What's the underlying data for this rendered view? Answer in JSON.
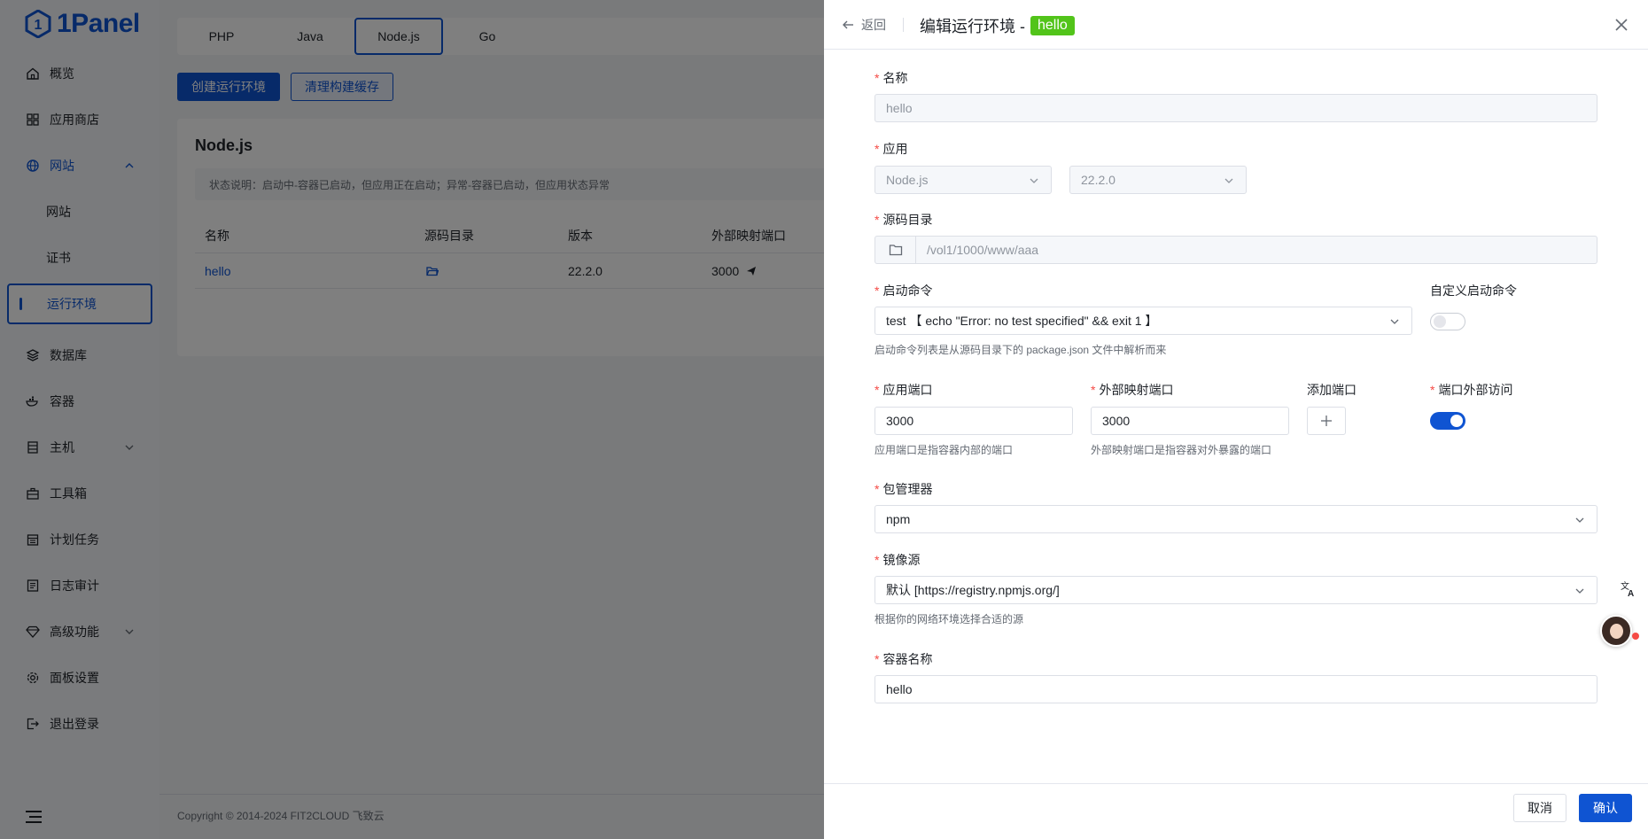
{
  "app": {
    "logo_text": "1Panel",
    "footer": "Copyright © 2014-2024 FIT2CLOUD 飞致云"
  },
  "sidebar": {
    "items": [
      {
        "label": "概览",
        "icon": "home-icon"
      },
      {
        "label": "应用商店",
        "icon": "grid-icon"
      },
      {
        "label": "网站",
        "icon": "globe-icon"
      },
      {
        "label": "网站",
        "icon": ""
      },
      {
        "label": "证书",
        "icon": ""
      },
      {
        "label": "运行环境",
        "icon": ""
      },
      {
        "label": "数据库",
        "icon": "layers-icon"
      },
      {
        "label": "容器",
        "icon": "docker-icon"
      },
      {
        "label": "主机",
        "icon": "server-icon"
      },
      {
        "label": "工具箱",
        "icon": "toolbox-icon"
      },
      {
        "label": "计划任务",
        "icon": "calendar-icon"
      },
      {
        "label": "日志审计",
        "icon": "log-icon"
      },
      {
        "label": "高级功能",
        "icon": "diamond-icon"
      },
      {
        "label": "面板设置",
        "icon": "gear-icon"
      },
      {
        "label": "退出登录",
        "icon": "logout-icon"
      }
    ]
  },
  "runtime_tabs": [
    "PHP",
    "Java",
    "Node.js",
    "Go"
  ],
  "toolbar": {
    "create_label": "创建运行环境",
    "clear_cache_label": "清理构建缓存"
  },
  "card": {
    "title": "Node.js",
    "status_note": "状态说明：启动中-容器已启动，但应用正在启动；异常-容器已启动，但应用状态异常"
  },
  "table": {
    "columns": [
      "名称",
      "源码目录",
      "版本",
      "外部映射端口"
    ],
    "rows": [
      {
        "name": "hello",
        "version": "22.2.0",
        "port": "3000"
      }
    ]
  },
  "drawer": {
    "back_label": "返回",
    "title": "编辑运行环境 -",
    "title_tag": "hello",
    "fields": {
      "name": {
        "label": "名称",
        "value": "hello"
      },
      "app": {
        "label": "应用",
        "app_value": "Node.js",
        "version_value": "22.2.0"
      },
      "source_dir": {
        "label": "源码目录",
        "value": "/vol1/1000/www/aaa"
      },
      "start_cmd": {
        "label": "启动命令",
        "value": "test 【 echo \"Error: no test specified\" && exit 1 】",
        "hint": "启动命令列表是从源码目录下的 package.json 文件中解析而来"
      },
      "custom_cmd": {
        "label": "自定义启动命令",
        "enabled": false
      },
      "app_port": {
        "label": "应用端口",
        "value": "3000",
        "hint": "应用端口是指容器内部的端口"
      },
      "ext_port": {
        "label": "外部映射端口",
        "value": "3000",
        "hint": "外部映射端口是指容器对外暴露的端口"
      },
      "add_port": {
        "label": "添加端口"
      },
      "port_external": {
        "label": "端口外部访问",
        "enabled": true
      },
      "pkg_manager": {
        "label": "包管理器",
        "value": "npm"
      },
      "mirror": {
        "label": "镜像源",
        "value": "默认 [https://registry.npmjs.org/]",
        "hint": "根据你的网络环境选择合适的源"
      },
      "container_name": {
        "label": "容器名称",
        "value": "hello"
      }
    },
    "cancel_label": "取消",
    "confirm_label": "确认"
  },
  "colors": {
    "primary": "#0f54d2",
    "tag_green": "#52c41a",
    "required": "#f54a45"
  }
}
